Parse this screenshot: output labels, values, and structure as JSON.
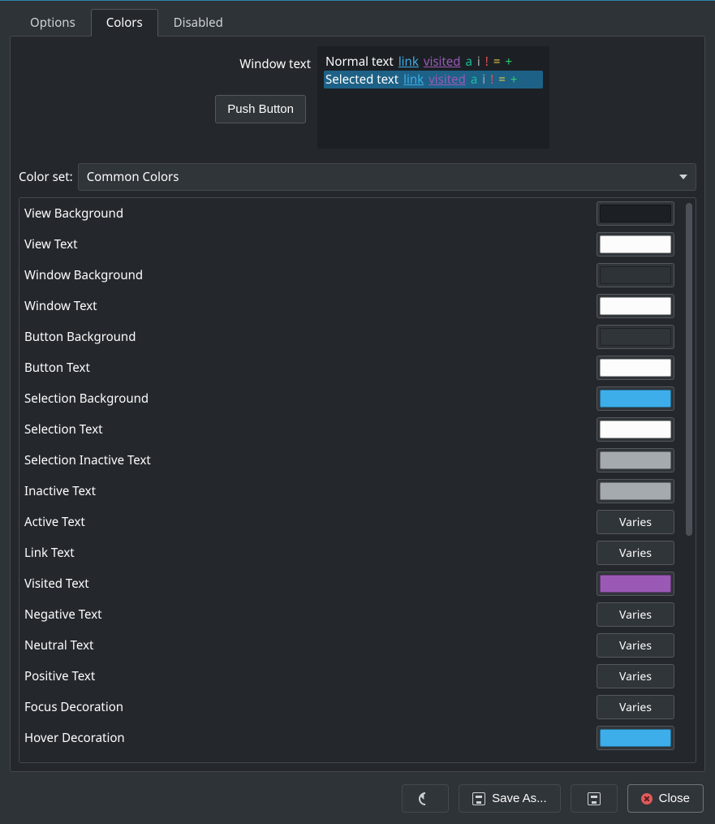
{
  "tabs": {
    "options": "Options",
    "colors": "Colors",
    "disabled": "Disabled"
  },
  "preview": {
    "window_text_label": "Window text",
    "push_button": "Push Button",
    "row_normal_label": "Normal text",
    "row_selected_label": "Selected text",
    "link": "link",
    "visited": "visited",
    "active": "a",
    "inactive": "i",
    "negative": "!",
    "neutral": "=",
    "positive": "+"
  },
  "colorset": {
    "label": "Color set:",
    "value": "Common Colors"
  },
  "varies_label": "Varies",
  "items": [
    {
      "label": "View Background",
      "color": "#1c2025"
    },
    {
      "label": "View Text",
      "color": "#fcfcfc"
    },
    {
      "label": "Window Background",
      "color": "#2e3338"
    },
    {
      "label": "Window Text",
      "color": "#fcfcfc"
    },
    {
      "label": "Button Background",
      "color": "#30353a"
    },
    {
      "label": "Button Text",
      "color": "#fcfcfc"
    },
    {
      "label": "Selection Background",
      "color": "#3daee9"
    },
    {
      "label": "Selection Text",
      "color": "#fcfcfc"
    },
    {
      "label": "Selection Inactive Text",
      "color": "#a5aaaf"
    },
    {
      "label": "Inactive Text",
      "color": "#a5aaaf"
    },
    {
      "label": "Active Text",
      "varies": true
    },
    {
      "label": "Link Text",
      "varies": true
    },
    {
      "label": "Visited Text",
      "color": "#9b59b6"
    },
    {
      "label": "Negative Text",
      "varies": true
    },
    {
      "label": "Neutral Text",
      "varies": true
    },
    {
      "label": "Positive Text",
      "varies": true
    },
    {
      "label": "Focus Decoration",
      "varies": true
    },
    {
      "label": "Hover Decoration",
      "color": "#3daee9"
    }
  ],
  "footer": {
    "save_as": "Save As...",
    "close": "Close"
  }
}
